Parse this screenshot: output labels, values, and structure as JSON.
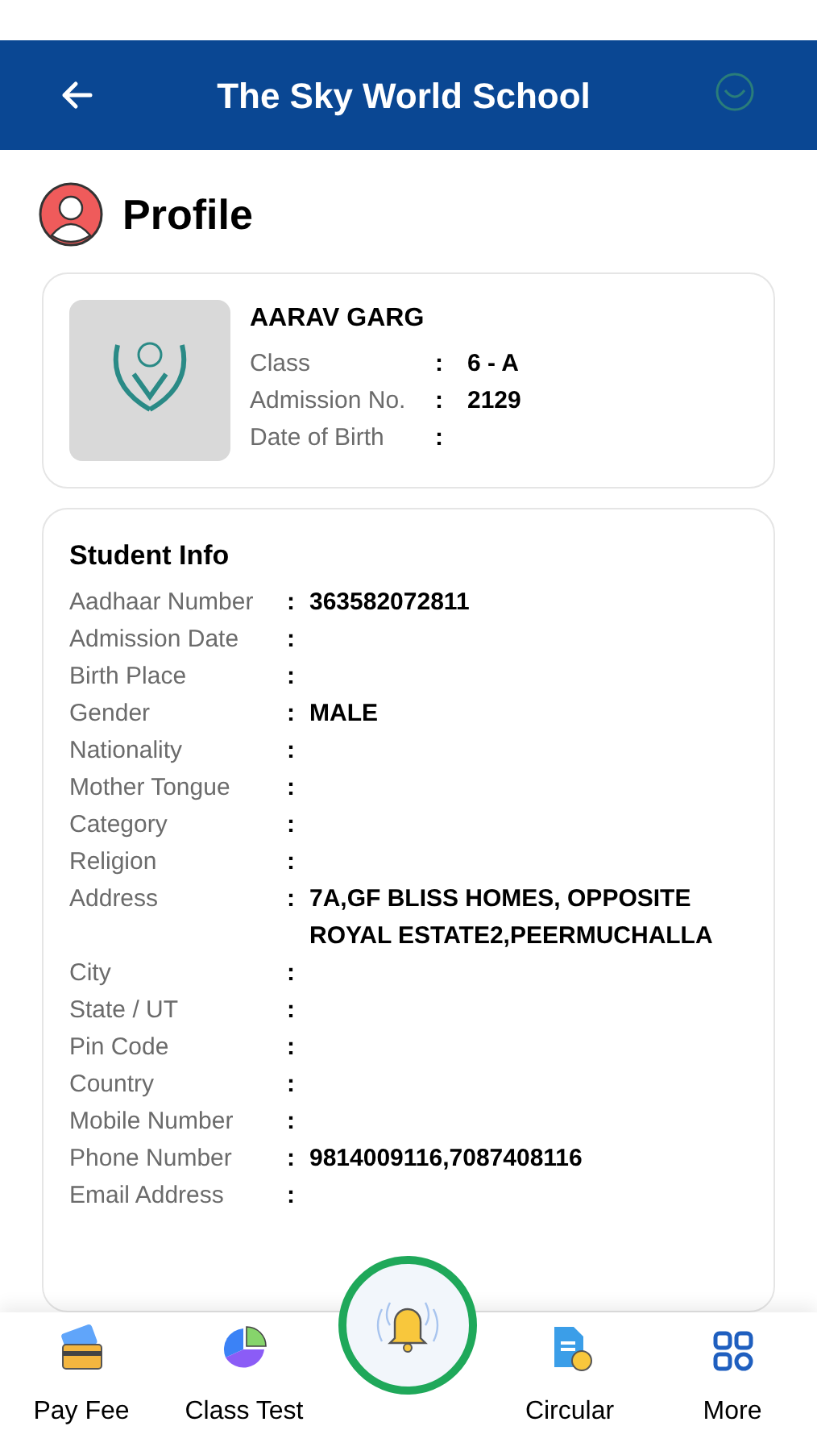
{
  "header": {
    "title": "The Sky World School"
  },
  "page_title": "Profile",
  "student": {
    "name": "AARAV GARG",
    "fields": [
      {
        "label": "Class",
        "separator": ":",
        "value": "6 - A"
      },
      {
        "label": "Admission No.",
        "separator": ":",
        "value": "2129"
      },
      {
        "label": "Date of Birth",
        "separator": ":"
      }
    ]
  },
  "student_info": {
    "title": "Student Info",
    "rows": [
      {
        "label": "Aadhaar Number",
        "separator": ":",
        "value": "363582072811"
      },
      {
        "label": "Admission Date",
        "separator": ":"
      },
      {
        "label": "Birth Place",
        "separator": ":"
      },
      {
        "label": "Gender",
        "separator": ":",
        "value": "MALE"
      },
      {
        "label": "Nationality",
        "separator": ":"
      },
      {
        "label": "Mother Tongue",
        "separator": ":"
      },
      {
        "label": "Category",
        "separator": ":"
      },
      {
        "label": "Religion",
        "separator": ":"
      },
      {
        "label": "Address",
        "separator": ":",
        "value": "7A,GF BLISS HOMES, OPPOSITE ROYAL ESTATE2,PEERMUCHALLA"
      },
      {
        "label": "City",
        "separator": ":"
      },
      {
        "label": "State / UT",
        "separator": ":"
      },
      {
        "label": "Pin Code",
        "separator": ":"
      },
      {
        "label": "Country",
        "separator": ":"
      },
      {
        "label": "Mobile Number",
        "separator": ":"
      },
      {
        "label": "Phone Number",
        "separator": ":",
        "value": "9814009116,7087408116"
      },
      {
        "label": "Email Address",
        "separator": ":"
      }
    ]
  },
  "bottom_nav": [
    {
      "label": "Pay Fee",
      "kind": "fee"
    },
    {
      "label": "Class Test",
      "kind": "test"
    },
    {
      "kind": "bell"
    },
    {
      "label": "Circular",
      "kind": "circular"
    },
    {
      "label": "More",
      "kind": "more"
    }
  ]
}
